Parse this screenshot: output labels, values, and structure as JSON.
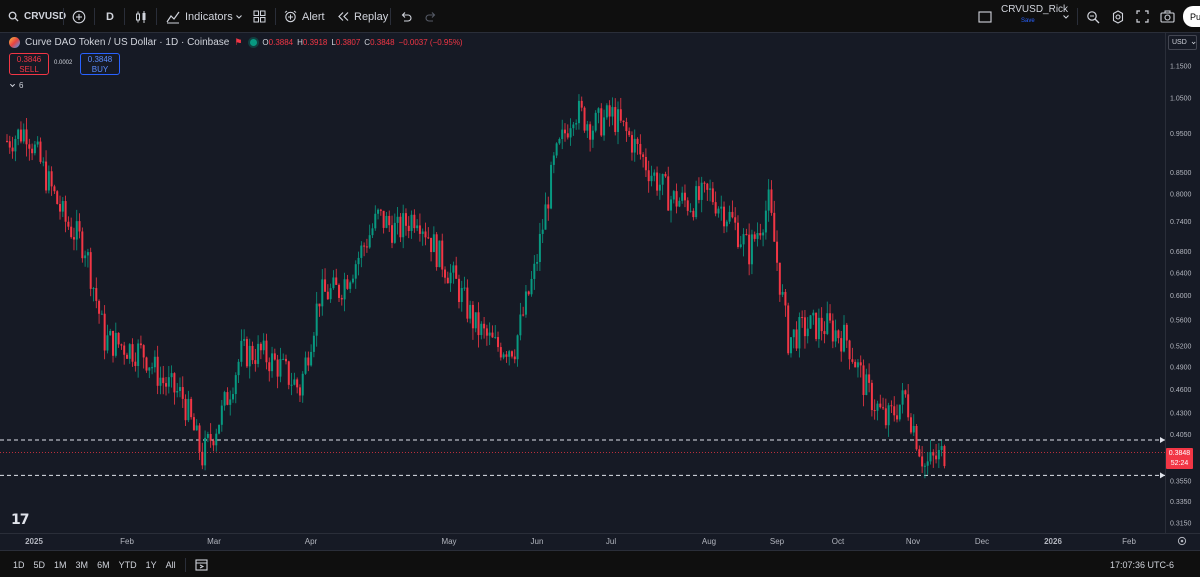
{
  "toolbar": {
    "symbol": "CRVUSD",
    "interval": "D",
    "indicators_label": "Indicators",
    "alert_label": "Alert",
    "replay_label": "Replay",
    "layout_name": "CRVUSD_Rick",
    "save_label": "Save",
    "publish_label": "Pu"
  },
  "legend": {
    "title": "Curve DAO Token / US Dollar · 1D · Coinbase",
    "open_label": "O",
    "open": "0.3884",
    "high_label": "H",
    "high": "0.3918",
    "low_label": "L",
    "low": "0.3807",
    "close_label": "C",
    "close": "0.3848",
    "change": "−0.0037 (−0.95%)",
    "change_color": "#f23645",
    "indicator_count": "6"
  },
  "trade": {
    "sell_price": "0.3846",
    "sell_label": "SELL",
    "buy_price": "0.3848",
    "buy_label": "BUY",
    "spread": "0.0002"
  },
  "currency": "USD",
  "current_price": {
    "price": "0.3848",
    "countdown": "52:24",
    "color": "#f23645"
  },
  "colors": {
    "up": "#089981",
    "down": "#f23645",
    "background": "#161a25"
  },
  "time_labels": [
    "2025",
    "Feb",
    "Mar",
    "Apr",
    "May",
    "Jun",
    "Jul",
    "Aug",
    "Sep",
    "Oct",
    "Nov",
    "Dec",
    "2026",
    "Feb"
  ],
  "range_buttons": [
    "1D",
    "5D",
    "1M",
    "3M",
    "6M",
    "YTD",
    "1Y",
    "All"
  ],
  "clock": "17:07:36 UTC-6",
  "chart_data": {
    "type": "candlestick",
    "symbol": "CRVUSD",
    "exchange": "Coinbase",
    "interval": "1D",
    "scale": "log",
    "y_ticks": [
      "1.1500",
      "1.0500",
      "0.9500",
      "0.8500",
      "0.8000",
      "0.7400",
      "0.6800",
      "0.6400",
      "0.6000",
      "0.5600",
      "0.5200",
      "0.4900",
      "0.4600",
      "0.4300",
      "0.4050",
      "0.3550",
      "0.3350",
      "0.3150"
    ],
    "x_ticks": [
      "2025",
      "Feb",
      "Mar",
      "Apr",
      "May",
      "Jun",
      "Jul",
      "Aug",
      "Sep",
      "Oct",
      "Nov",
      "Dec",
      "2026",
      "Feb"
    ],
    "horizontal_lines": [
      0.3985,
      0.3605
    ],
    "last_close": 0.3848,
    "weekly_close_approx": [
      {
        "week": "2024-12-30",
        "close": 0.93
      },
      {
        "week": "2025-01-06",
        "close": 0.96
      },
      {
        "week": "2025-01-13",
        "close": 0.84
      },
      {
        "week": "2025-01-20",
        "close": 0.74
      },
      {
        "week": "2025-01-27",
        "close": 0.69
      },
      {
        "week": "2025-02-03",
        "close": 0.53
      },
      {
        "week": "2025-02-10",
        "close": 0.52
      },
      {
        "week": "2025-02-17",
        "close": 0.51
      },
      {
        "week": "2025-02-24",
        "close": 0.47
      },
      {
        "week": "2025-03-03",
        "close": 0.45
      },
      {
        "week": "2025-03-10",
        "close": 0.38
      },
      {
        "week": "2025-03-17",
        "close": 0.43
      },
      {
        "week": "2025-03-24",
        "close": 0.51
      },
      {
        "week": "2025-03-31",
        "close": 0.51
      },
      {
        "week": "2025-04-07",
        "close": 0.49
      },
      {
        "week": "2025-04-14",
        "close": 0.46
      },
      {
        "week": "2025-04-21",
        "close": 0.6
      },
      {
        "week": "2025-04-28",
        "close": 0.61
      },
      {
        "week": "2025-05-05",
        "close": 0.67
      },
      {
        "week": "2025-05-12",
        "close": 0.75
      },
      {
        "week": "2025-05-19",
        "close": 0.72
      },
      {
        "week": "2025-05-26",
        "close": 0.76
      },
      {
        "week": "2025-06-02",
        "close": 0.68
      },
      {
        "week": "2025-06-09",
        "close": 0.62
      },
      {
        "week": "2025-06-16",
        "close": 0.55
      },
      {
        "week": "2025-06-23",
        "close": 0.52
      },
      {
        "week": "2025-06-30",
        "close": 0.52
      },
      {
        "week": "2025-07-07",
        "close": 0.64
      },
      {
        "week": "2025-07-14",
        "close": 0.87
      },
      {
        "week": "2025-07-21",
        "close": 1.02
      },
      {
        "week": "2025-07-28",
        "close": 0.97
      },
      {
        "week": "2025-08-04",
        "close": 1.0
      },
      {
        "week": "2025-08-11",
        "close": 0.93
      },
      {
        "week": "2025-08-18",
        "close": 0.85
      },
      {
        "week": "2025-08-25",
        "close": 0.79
      },
      {
        "week": "2025-09-01",
        "close": 0.78
      },
      {
        "week": "2025-09-08",
        "close": 0.8
      },
      {
        "week": "2025-09-15",
        "close": 0.75
      },
      {
        "week": "2025-09-22",
        "close": 0.68
      },
      {
        "week": "2025-09-29",
        "close": 0.78
      },
      {
        "week": "2025-10-06",
        "close": 0.53
      },
      {
        "week": "2025-10-13",
        "close": 0.55
      },
      {
        "week": "2025-10-20",
        "close": 0.55
      },
      {
        "week": "2025-10-27",
        "close": 0.53
      },
      {
        "week": "2025-11-03",
        "close": 0.46
      },
      {
        "week": "2025-11-10",
        "close": 0.42
      },
      {
        "week": "2025-11-17",
        "close": 0.45
      },
      {
        "week": "2025-11-24",
        "close": 0.37
      },
      {
        "week": "2025-12-01",
        "close": 0.3848
      }
    ]
  }
}
